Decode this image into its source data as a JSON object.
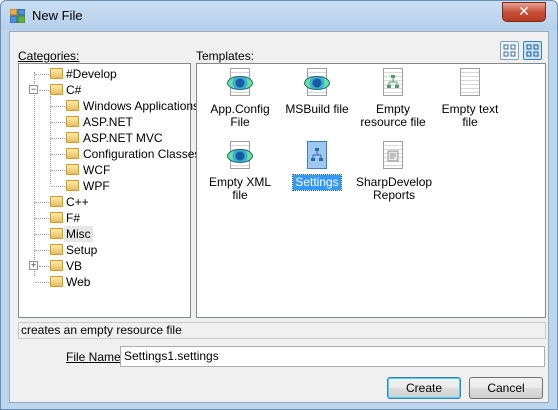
{
  "window": {
    "title": "New File",
    "close_label": "✕"
  },
  "labels": {
    "categories": "Categories:",
    "templates": "Templates:",
    "file_name": "File Name"
  },
  "categories": [
    {
      "label": "#Develop",
      "level": 0
    },
    {
      "label": "C#",
      "level": 0,
      "expanded": true
    },
    {
      "label": "Windows Applications",
      "level": 1
    },
    {
      "label": "ASP.NET",
      "level": 1
    },
    {
      "label": "ASP.NET MVC",
      "level": 1
    },
    {
      "label": "Configuration Classes",
      "level": 1
    },
    {
      "label": "WCF",
      "level": 1
    },
    {
      "label": "WPF",
      "level": 1
    },
    {
      "label": "C++",
      "level": 0
    },
    {
      "label": "F#",
      "level": 0
    },
    {
      "label": "Misc",
      "level": 0,
      "selected": true
    },
    {
      "label": "Setup",
      "level": 0
    },
    {
      "label": "VB",
      "level": 0,
      "collapsed": true
    },
    {
      "label": "Web",
      "level": 0
    }
  ],
  "templates": [
    {
      "label": "App.Config File",
      "icon": "xml-eye-icon"
    },
    {
      "label": "MSBuild file",
      "icon": "xml-eye-icon"
    },
    {
      "label": "Empty resource file",
      "icon": "resource-file-icon"
    },
    {
      "label": "Empty text file",
      "icon": "text-file-icon"
    },
    {
      "label": "Empty XML file",
      "icon": "xml-eye-icon"
    },
    {
      "label": "Settings",
      "icon": "settings-file-icon",
      "selected": true
    },
    {
      "label": "SharpDevelop Reports",
      "icon": "report-file-icon"
    }
  ],
  "status_text": "creates an empty resource file",
  "file_name_value": "Settings1.settings",
  "buttons": {
    "create": "Create",
    "cancel": "Cancel"
  },
  "colors": {
    "selection": "#3399ff",
    "close_button": "#c7503a",
    "frame": "#bcd6ee"
  }
}
